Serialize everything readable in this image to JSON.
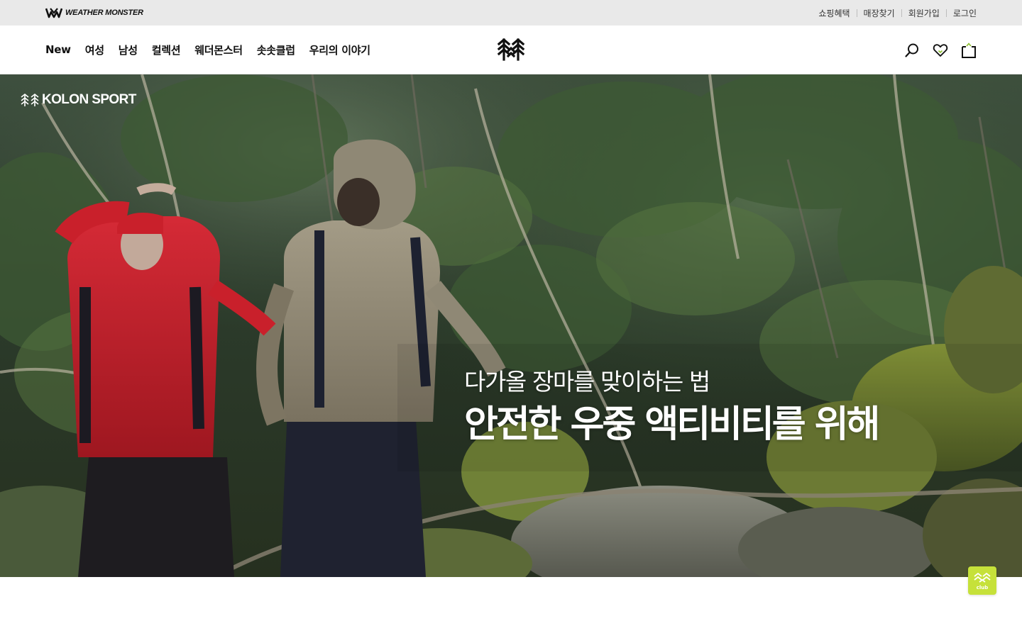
{
  "topbar": {
    "brand_text": "WEATHER MONSTER",
    "links": [
      "쇼핑혜택",
      "매장찾기",
      "회원가입",
      "로그인"
    ]
  },
  "header": {
    "nav": [
      "New",
      "여성",
      "남성",
      "컬렉션",
      "웨더몬스터",
      "솟솟클럽",
      "우리의 이야기"
    ],
    "icons": [
      "search-icon",
      "heart-icon",
      "cart-icon"
    ]
  },
  "hero": {
    "brand_text": "KOLON SPORT",
    "subtitle": "다가올 장마를 맞이하는 법",
    "title": "안전한 우중 액티비티를 위해"
  },
  "floating": {
    "club_label": "club"
  },
  "colors": {
    "topbar_bg": "#e9e9e9",
    "club_accent": "#c6e13a",
    "heart_accent": "#8bbf2e"
  }
}
